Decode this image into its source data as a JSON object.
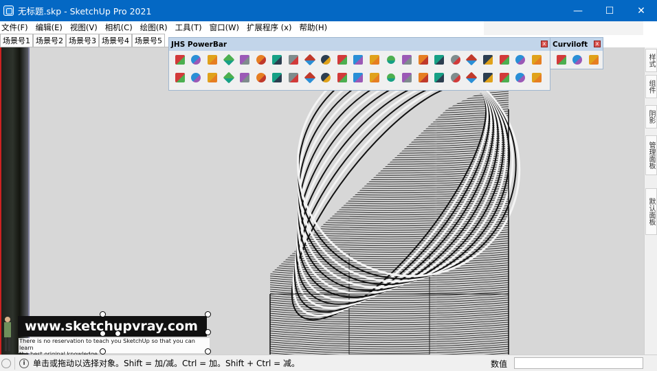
{
  "window": {
    "title": "无标题.skp - SketchUp Pro 2021",
    "minimize_glyph": "—",
    "maximize_glyph": "☐",
    "close_glyph": "✕"
  },
  "menu": [
    "文件(F)",
    "编辑(E)",
    "视图(V)",
    "相机(C)",
    "绘图(R)",
    "工具(T)",
    "窗口(W)",
    "扩展程序 (x)",
    "帮助(H)"
  ],
  "scene_tabs": [
    "场景号1",
    "场景号2",
    "场景号3",
    "场景号4",
    "场景号5"
  ],
  "active_scene_index": 4,
  "powerbar": {
    "title": "JHS PowerBar",
    "row1_icons": [
      "push-pull-icon",
      "face-icon",
      "layer-icon",
      "green-face-icon",
      "red-face-icon",
      "paper-icon",
      "rotate-icon",
      "fill-icon",
      "brush-icon",
      "square-red-icon",
      "frame-icon",
      "flag-icon",
      "mesh-icon",
      "pipe-icon",
      "fold-icon",
      "curve-dots-icon",
      "spline-icon",
      "red-cross-icon",
      "green-cross-icon",
      "blue-x-icon",
      "grid-dots-icon",
      "green-cone-icon",
      "teal-tree-icon"
    ],
    "row2_icons": [
      "warning-icon",
      "arc-icon",
      "hook-icon",
      "rotate-arc-icon",
      "move-star-icon",
      "box-icon",
      "magnet-icon",
      "puzzle-icon",
      "extrude-icon",
      "red-puzzle-icon",
      "red-puzzle-2-icon",
      "red-diamond-icon",
      "flower-icon",
      "grid-icon",
      "grid-2-icon",
      "red-grid-icon",
      "green-grid-icon",
      "orange-block-icon",
      "orange-block-2-icon",
      "orange-block-3-icon",
      "red-x-icon",
      "circle-dots-icon",
      "blue-grid-icon"
    ]
  },
  "curviloft": {
    "title": "Curviloft",
    "icons": [
      "shield-loft-icon",
      "loft-path-icon",
      "skin-contour-icon"
    ]
  },
  "side_tabs": [
    "样式",
    "组件",
    "阴影",
    "管理面板",
    "默认面板"
  ],
  "status": {
    "hint": "单击或拖动以选择对象。Shift = 加/减。Ctrl = 加。Shift + Ctrl = 减。",
    "measure_label": "数值",
    "measure_value": ""
  },
  "watermark": {
    "url": "www.sketchupvray.com",
    "tagline_line1": "There is no reservation to teach you SketchUp so that you can learn",
    "tagline_line2": "the best original knowledge."
  },
  "colors": {
    "titlebar": "#0468c4",
    "viewport_bg": "#d7d7d7",
    "panel_header": "#c2d5ea"
  }
}
